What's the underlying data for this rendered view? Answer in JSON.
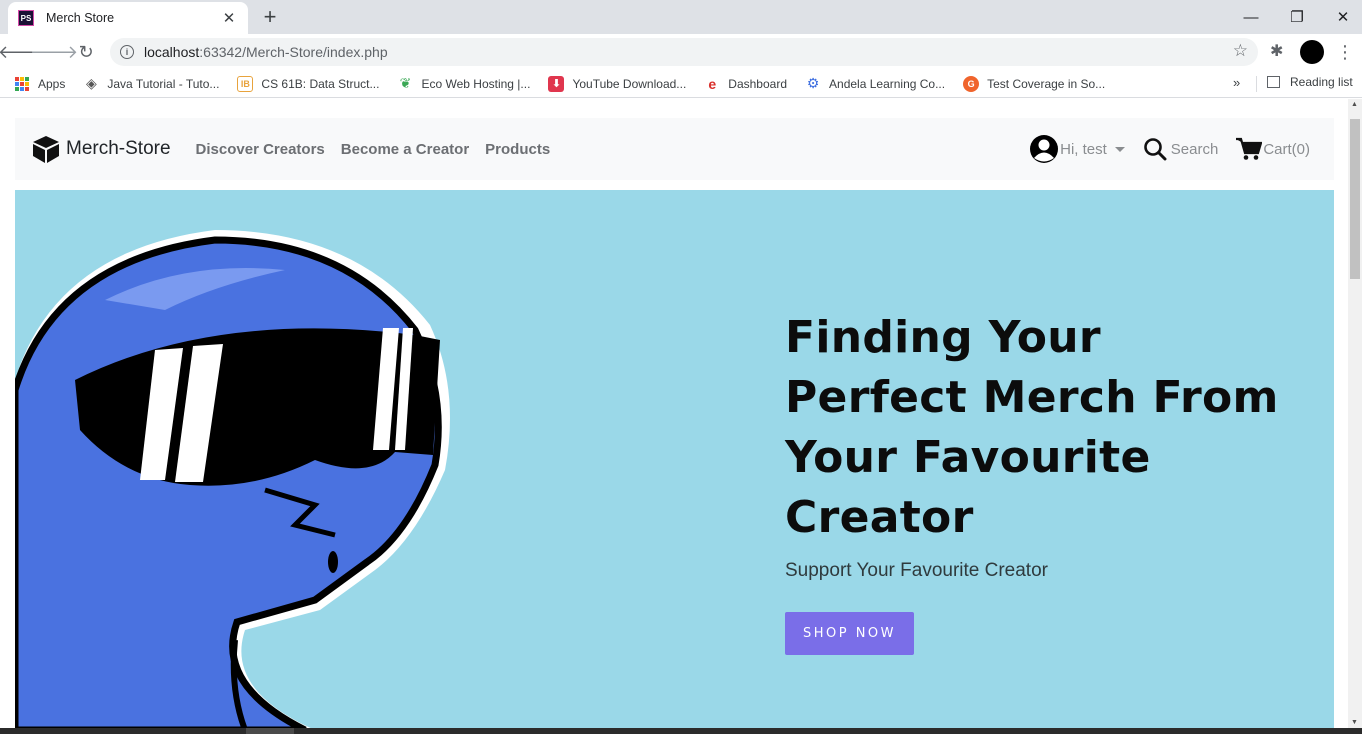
{
  "browser": {
    "tab_title": "Merch Store",
    "tab_favicon_text": "PS",
    "url_host": "localhost",
    "url_path": ":63342/Merch-Store/index.php",
    "bookmarks": [
      {
        "label": "Apps",
        "icon": "apps-grid-icon"
      },
      {
        "label": "Java Tutorial - Tuto...",
        "icon": "java-icon"
      },
      {
        "label": "CS 61B: Data Struct...",
        "icon": "cs61b-icon"
      },
      {
        "label": "Eco Web Hosting |...",
        "icon": "leaf-icon"
      },
      {
        "label": "YouTube Download...",
        "icon": "download-icon"
      },
      {
        "label": "Dashboard",
        "icon": "edge-icon"
      },
      {
        "label": "Andela Learning Co...",
        "icon": "andela-icon"
      },
      {
        "label": "Test Coverage in So...",
        "icon": "coverage-icon"
      }
    ],
    "bookmarks_more": "»",
    "reading_list": "Reading list"
  },
  "site": {
    "brand": "Merch-Store",
    "nav": [
      "Discover Creators",
      "Become a Creator",
      "Products"
    ],
    "user_greeting": "Hi, test",
    "search_label": "Search",
    "cart_label": "Cart(0)"
  },
  "hero": {
    "title": "Finding Your Perfect Merch From Your Favourite Creator",
    "title_lines": [
      "Finding Your",
      "Perfect Merch From",
      "Your Favourite",
      "Creator"
    ],
    "subtitle": "Support Your Favourite Creator",
    "cta": "SHOP NOW"
  },
  "colors": {
    "hero_bg": "#9ad8e8",
    "cta_bg": "#7a6ee8",
    "navbar_bg": "#f8f9fa",
    "character_blue": "#4a72e0"
  }
}
